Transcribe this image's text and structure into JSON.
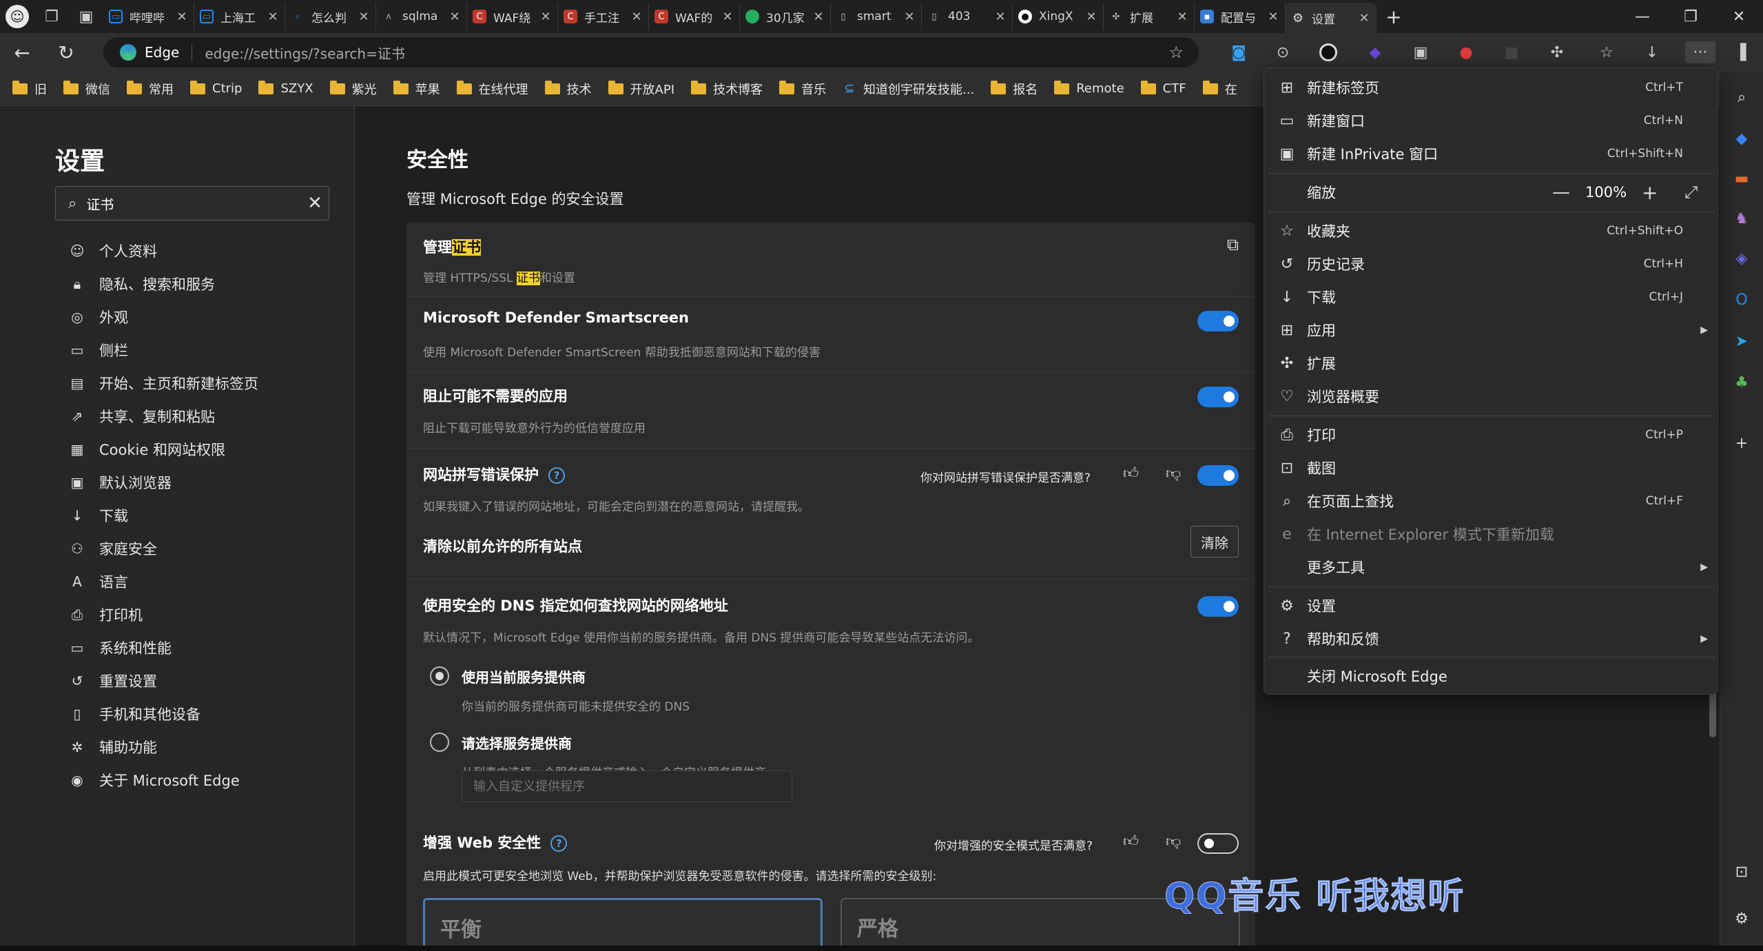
{
  "tabs": [
    {
      "label": "哔哩哔",
      "icon": "tv-icon",
      "color": "#1e8cf0"
    },
    {
      "label": "上海工",
      "icon": "tv-icon",
      "color": "#1e8cf0"
    },
    {
      "label": "怎么判",
      "icon": "search-icon",
      "color": "#3a6fd8"
    },
    {
      "label": "sqlma",
      "icon": "wolf-icon",
      "color": "#999999"
    },
    {
      "label": "WAF绕",
      "icon": "c-icon",
      "color": "#c0392b"
    },
    {
      "label": "手工注",
      "icon": "c-icon",
      "color": "#c0392b"
    },
    {
      "label": "WAF的",
      "icon": "c-icon",
      "color": "#c0392b"
    },
    {
      "label": "30几家",
      "icon": "wechat-icon",
      "color": "#27ae60"
    },
    {
      "label": "smart",
      "icon": "doc-icon",
      "color": "#cccccc"
    },
    {
      "label": "403",
      "icon": "doc-icon",
      "color": "#cccccc"
    },
    {
      "label": "XingX",
      "icon": "github-icon",
      "color": "#ffffff"
    },
    {
      "label": "扩展",
      "icon": "puzzle-icon",
      "color": "#cccccc"
    },
    {
      "label": "配置与",
      "icon": "image-icon",
      "color": "#3a7bd5"
    },
    {
      "label": "设置",
      "icon": "gear-icon",
      "color": "#cccccc"
    }
  ],
  "address": {
    "site": "Edge",
    "url": "edge://settings/?search=证书"
  },
  "bookmarks": [
    "旧",
    "微信",
    "常用",
    "Ctrip",
    "SZYX",
    "紫光",
    "苹果",
    "在线代理",
    "技术",
    "开放API",
    "技术博客",
    "音乐",
    "知道创宇研发技能...",
    "报名",
    "Remote",
    "CTF",
    "在"
  ],
  "sidebar": {
    "title": "设置",
    "search_value": "证书",
    "items": [
      {
        "label": "个人资料",
        "icon": "profile-icon"
      },
      {
        "label": "隐私、搜索和服务",
        "icon": "lock-icon"
      },
      {
        "label": "外观",
        "icon": "palette-icon"
      },
      {
        "label": "侧栏",
        "icon": "sidebar-icon"
      },
      {
        "label": "开始、主页和新建标签页",
        "icon": "home-icon"
      },
      {
        "label": "共享、复制和粘贴",
        "icon": "share-icon"
      },
      {
        "label": "Cookie 和网站权限",
        "icon": "cookie-icon"
      },
      {
        "label": "默认浏览器",
        "icon": "browser-icon"
      },
      {
        "label": "下载",
        "icon": "download-icon"
      },
      {
        "label": "家庭安全",
        "icon": "family-icon"
      },
      {
        "label": "语言",
        "icon": "language-icon"
      },
      {
        "label": "打印机",
        "icon": "printer-icon"
      },
      {
        "label": "系统和性能",
        "icon": "system-icon"
      },
      {
        "label": "重置设置",
        "icon": "reset-icon"
      },
      {
        "label": "手机和其他设备",
        "icon": "phone-icon"
      },
      {
        "label": "辅助功能",
        "icon": "accessibility-icon"
      },
      {
        "label": "关于 Microsoft Edge",
        "icon": "edge-icon"
      }
    ]
  },
  "main": {
    "title": "安全性",
    "subtitle": "管理 Microsoft Edge 的安全设置",
    "cert_title_pre": "管理",
    "cert_title_hl": "证书",
    "cert_desc_pre": "管理 HTTPS/SSL ",
    "cert_desc_hl": "证书",
    "cert_desc_post": "和设置",
    "smartscreen_title": "Microsoft Defender Smartscreen",
    "smartscreen_desc": "使用 Microsoft Defender SmartScreen 帮助我抵御恶意网站和下载的侵害",
    "smartscreen_on": true,
    "pua_title": "阻止可能不需要的应用",
    "pua_desc": "阻止下载可能导致意外行为的低信誉度应用",
    "pua_on": true,
    "typo_title": "网站拼写错误保护",
    "typo_feedback": "你对网站拼写错误保护是否满意?",
    "typo_desc": "如果我键入了错误的网站地址，可能会定向到潜在的恶意网站，请提醒我。",
    "typo_on": true,
    "clear_title": "清除以前允许的所有站点",
    "clear_button": "清除",
    "dns_title": "使用安全的 DNS 指定如何查找网站的网络地址",
    "dns_desc": "默认情况下，Microsoft Edge 使用你当前的服务提供商。备用 DNS 提供商可能会导致某些站点无法访问。",
    "dns_on": true,
    "dns_opt1_label": "使用当前服务提供商",
    "dns_opt1_desc": "你当前的服务提供商可能未提供安全的 DNS",
    "dns_opt2_label": "请选择服务提供商",
    "dns_opt2_desc": "从列表中选择一个服务提供商或输入一个自定义服务提供商",
    "dns_custom_placeholder": "输入自定义提供程序",
    "enhanced_title": "增强 Web 安全性",
    "enhanced_feedback": "你对增强的安全模式是否满意?",
    "enhanced_desc": "启用此模式可更安全地浏览 Web，并帮助保护浏览器免受恶意软件的侵害。请选择所需的安全级别:",
    "enhanced_on": false,
    "level_balanced": "平衡",
    "level_strict": "严格"
  },
  "menu": {
    "items": [
      {
        "label": "新建标签页",
        "key": "Ctrl+T",
        "icon": "new-tab-icon"
      },
      {
        "label": "新建窗口",
        "key": "Ctrl+N",
        "icon": "new-window-icon"
      },
      {
        "label": "新建 InPrivate 窗口",
        "key": "Ctrl+Shift+N",
        "icon": "inprivate-icon"
      },
      {
        "label": "缩放",
        "key": "",
        "icon": ""
      },
      {
        "label": "收藏夹",
        "key": "Ctrl+Shift+O",
        "icon": "favorites-icon"
      },
      {
        "label": "历史记录",
        "key": "Ctrl+H",
        "icon": "history-icon"
      },
      {
        "label": "下载",
        "key": "Ctrl+J",
        "icon": "download-icon"
      },
      {
        "label": "应用",
        "key": "",
        "icon": "apps-icon"
      },
      {
        "label": "扩展",
        "key": "",
        "icon": "extensions-icon"
      },
      {
        "label": "浏览器概要",
        "key": "",
        "icon": "heart-pulse-icon"
      },
      {
        "label": "打印",
        "key": "Ctrl+P",
        "icon": "print-icon"
      },
      {
        "label": "截图",
        "key": "",
        "icon": "screenshot-icon"
      },
      {
        "label": "在页面上查找",
        "key": "Ctrl+F",
        "icon": "find-icon"
      },
      {
        "label": "在 Internet Explorer 模式下重新加载",
        "key": "",
        "icon": "ie-icon"
      },
      {
        "label": "更多工具",
        "key": "",
        "icon": ""
      },
      {
        "label": "设置",
        "key": "",
        "icon": "gear-icon"
      },
      {
        "label": "帮助和反馈",
        "key": "",
        "icon": "help-icon"
      },
      {
        "label": "关闭 Microsoft Edge",
        "key": "",
        "icon": ""
      }
    ],
    "zoom": "100%"
  },
  "overlay": {
    "lyrics": "QQ音乐 听我想听"
  },
  "colors": {
    "accent": "#1f7ae0",
    "highlight": "#f2d22e",
    "lyrics": "#3f6edb"
  }
}
